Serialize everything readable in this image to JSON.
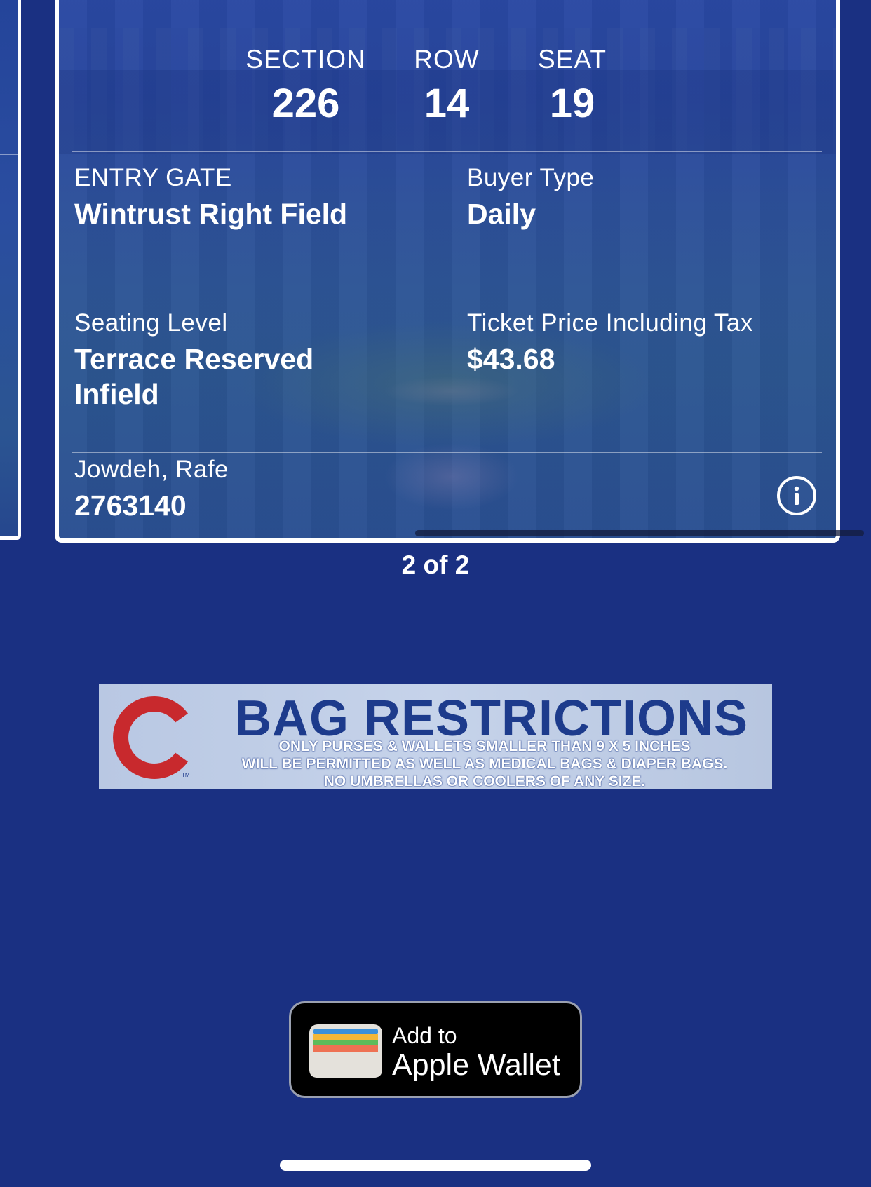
{
  "ticket": {
    "section_label": "SECTION",
    "section": "226",
    "row_label": "ROW",
    "row": "14",
    "seat_label": "SEAT",
    "seat": "19",
    "entry_gate_label": "ENTRY GATE",
    "entry_gate": "Wintrust Right Field",
    "buyer_type_label": "Buyer Type",
    "buyer_type": "Daily",
    "seating_level_label": "Seating Level",
    "seating_level": "Terrace Reserved Infield",
    "price_label": "Ticket Price Including Tax",
    "price": "$43.68",
    "holder_name": "Jowdeh, Rafe",
    "ticket_number": "2763140"
  },
  "pager": {
    "text": "2 of 2"
  },
  "banner": {
    "title": "BAG RESTRICTIONS",
    "body": "ONLY PURSES & WALLETS  SMALLER THAN 9 X 5 INCHES\nWILL BE PERMITTED AS WELL AS MEDICAL BAGS & DIAPER BAGS.\nNO UMBRELLAS OR COOLERS OF ANY SIZE.",
    "logo_letter": "C",
    "logo_tm": "TM",
    "logo_color": "#c8292d"
  },
  "wallet": {
    "line1": "Add to",
    "line2": "Apple Wallet",
    "icon": "wallet-icon"
  },
  "colors": {
    "background": "#1a3082",
    "brand_blue": "#1d3b8c"
  }
}
